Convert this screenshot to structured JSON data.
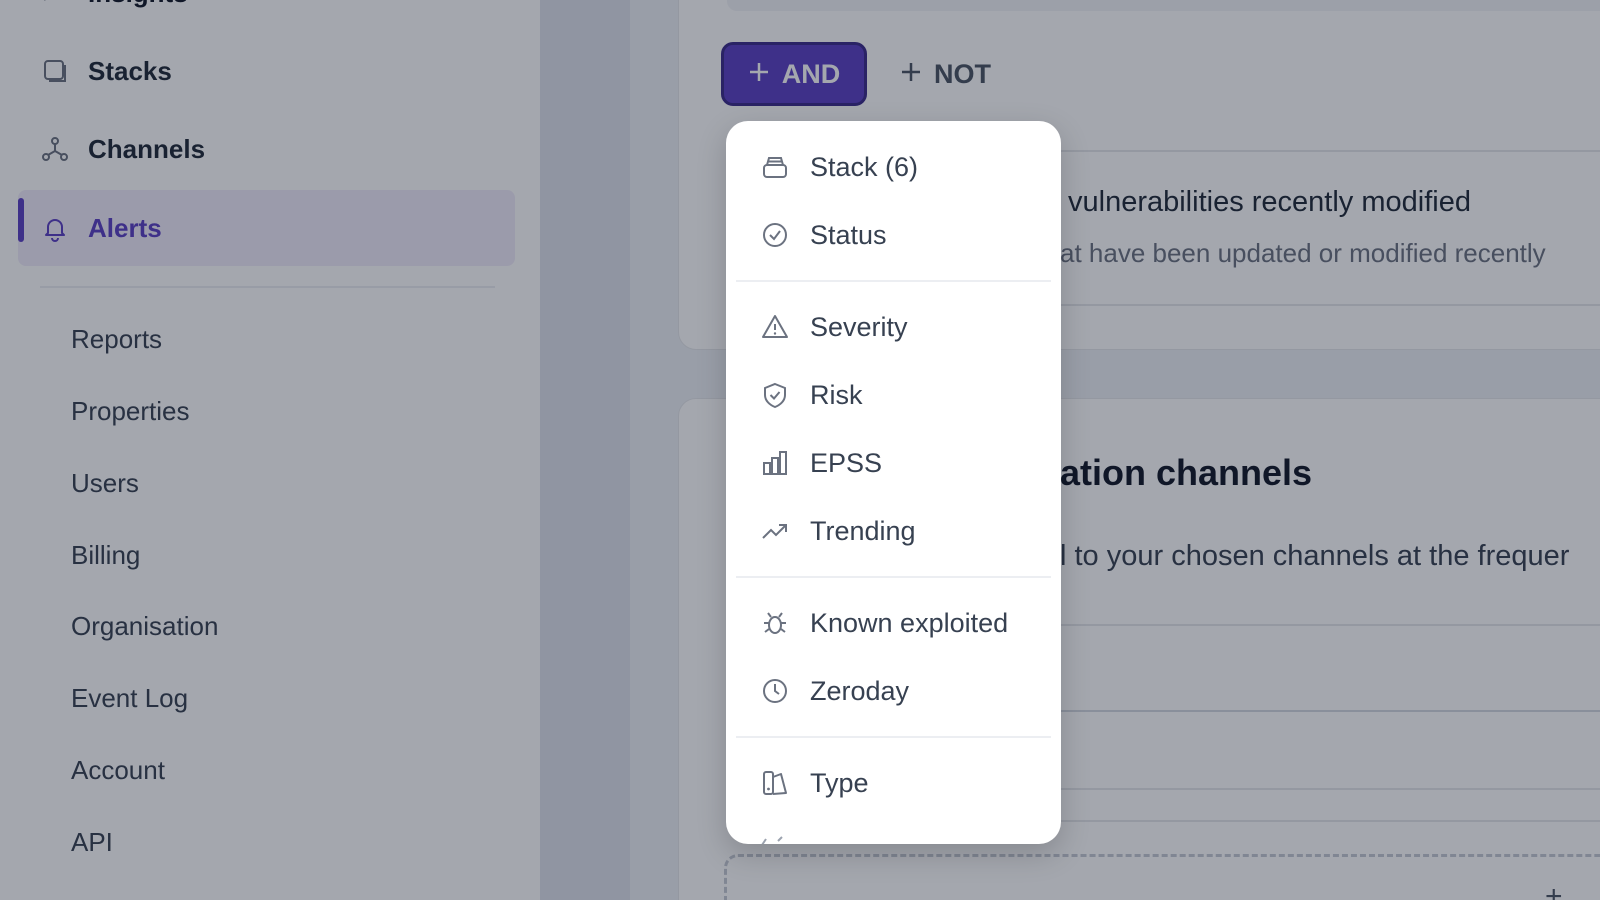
{
  "sidebar": {
    "top_partial": "Insights",
    "items": [
      {
        "label": "Stacks",
        "icon": "stack-square-icon"
      },
      {
        "label": "Channels",
        "icon": "network-icon"
      },
      {
        "label": "Alerts",
        "icon": "bell-icon",
        "active": true
      }
    ],
    "sub_items": [
      "Reports",
      "Properties",
      "Users",
      "Billing",
      "Organisation",
      "Event Log",
      "Account",
      "API"
    ]
  },
  "filter_buttons": {
    "and_label": "AND",
    "not_label": "NOT"
  },
  "rule": {
    "title": "vulnerabilities recently modified",
    "description": "at have been updated or modified recently"
  },
  "notification_section": {
    "title": "ation channels",
    "description": "l to your chosen channels at the frequer"
  },
  "dropdown": {
    "groups": [
      [
        {
          "label": "Stack (6)",
          "icon": "stack-icon"
        },
        {
          "label": "Status",
          "icon": "check-circle-icon"
        }
      ],
      [
        {
          "label": "Severity",
          "icon": "warning-triangle-icon"
        },
        {
          "label": "Risk",
          "icon": "shield-check-icon"
        },
        {
          "label": "EPSS",
          "icon": "bar-chart-icon"
        },
        {
          "label": "Trending",
          "icon": "trending-up-icon"
        }
      ],
      [
        {
          "label": "Known exploited",
          "icon": "bug-icon"
        },
        {
          "label": "Zeroday",
          "icon": "clock-icon"
        }
      ],
      [
        {
          "label": "Type",
          "icon": "shapes-icon"
        }
      ]
    ]
  },
  "colors": {
    "accent": "#5b3fc4",
    "overlay": "rgba(15,23,42,0.38)"
  }
}
